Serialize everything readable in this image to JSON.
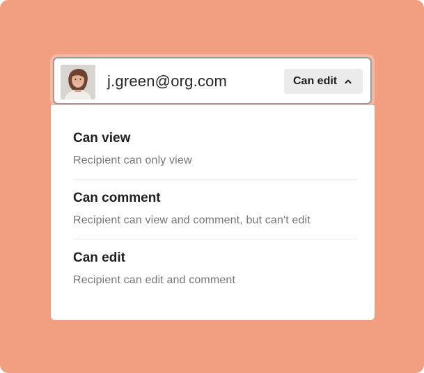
{
  "share_row": {
    "email": "j.green@org.com",
    "permission_button_label": "Can edit"
  },
  "permission_menu": {
    "options": [
      {
        "title": "Can view",
        "description": "Recipient can only view"
      },
      {
        "title": "Can comment",
        "description": "Recipient can view and comment, but can't edit"
      },
      {
        "title": "Can edit",
        "description": "Recipient can edit and comment"
      }
    ]
  },
  "colors": {
    "background": "#f29e80",
    "focus_ring": "#f5b9a3",
    "button_bg": "#ebebeb",
    "text_primary": "#1f1f1f",
    "text_secondary": "#757575"
  },
  "icons": {
    "avatar": "user-photo",
    "permission_chevron": "chevron-up-icon"
  }
}
